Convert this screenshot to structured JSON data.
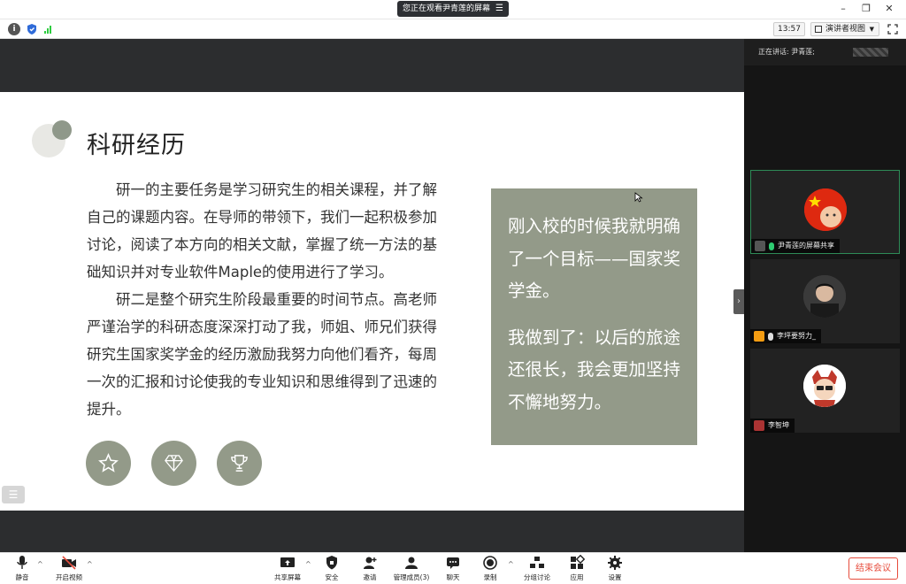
{
  "title_bar": {
    "share_status": "您正在观看尹青莲的屏幕",
    "minimize": "–",
    "restore": "❐",
    "close": "✕"
  },
  "toolbar": {
    "time": "13:57",
    "view_mode": "演讲者视图"
  },
  "slide": {
    "title": "科研经历",
    "paragraphs": [
      "研一的主要任务是学习研究生的相关课程，并了解自己的课题内容。在导师的带领下，我们一起积极参加讨论，阅读了本方向的相关文献，掌握了统一方法的基础知识并对专业软件Maple的使用进行了学习。",
      "研二是整个研究生阶段最重要的时间节点。高老师严谨治学的科研态度深深打动了我，师姐、师兄们获得研究生国家奖学金的经历激励我努力向他们看齐，每周一次的汇报和讨论使我的专业知识和思维得到了迅速的提升。"
    ],
    "quote": [
      "刚入校的时候我就明确了一个目标——国家奖学金。",
      "我做到了：以后的旅途还很长，我会更加坚持不懈地努力。"
    ],
    "icons": [
      "star-icon",
      "diamond-icon",
      "trophy-icon"
    ],
    "accent_color": "#939a89"
  },
  "panel": {
    "speaking_label": "正在讲话: 尹青莲;",
    "participants": [
      {
        "name": "尹青莲的屏幕共享",
        "active": true
      },
      {
        "name": "李坪要努力_",
        "active": false
      },
      {
        "name": "李智坤",
        "active": false
      }
    ]
  },
  "bottom_bar": {
    "mute": "静音",
    "start_video": "开启视频",
    "share_screen": "共享屏幕",
    "security": "安全",
    "invite": "邀请",
    "manage_members": "管理成员(3)",
    "chat": "聊天",
    "record": "录制",
    "breakout": "分组讨论",
    "apps": "应用",
    "settings": "设置",
    "end_meeting": "结束会议"
  }
}
